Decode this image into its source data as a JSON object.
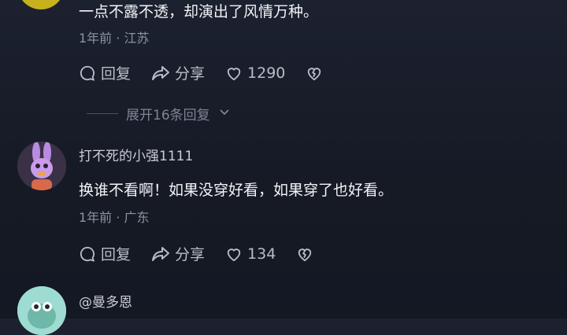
{
  "comments": [
    {
      "text": "一点不露不透，却演出了风情万种。",
      "meta": "1年前 · 江苏",
      "reply_label": "回复",
      "share_label": "分享",
      "like_count": "1290",
      "avatar_color": "#c7b11d"
    },
    {
      "username": "打不死的小强1111",
      "text": "换谁不看啊！如果没穿好看，如果穿了也好看。",
      "meta": "1年前 · 广东",
      "reply_label": "回复",
      "share_label": "分享",
      "like_count": "134",
      "avatar_color": "#2f2a3a"
    },
    {
      "username": "@曼多恩",
      "avatar_color": "#8fd3c7"
    }
  ],
  "expand_replies": "展开16条回复",
  "colors": {
    "background": "#181c27",
    "text": "#f3f4f7",
    "muted": "#8d93a2"
  },
  "icons": [
    "reply-icon",
    "share-icon",
    "heart-icon",
    "dislike-icon",
    "chevron-down-icon"
  ]
}
